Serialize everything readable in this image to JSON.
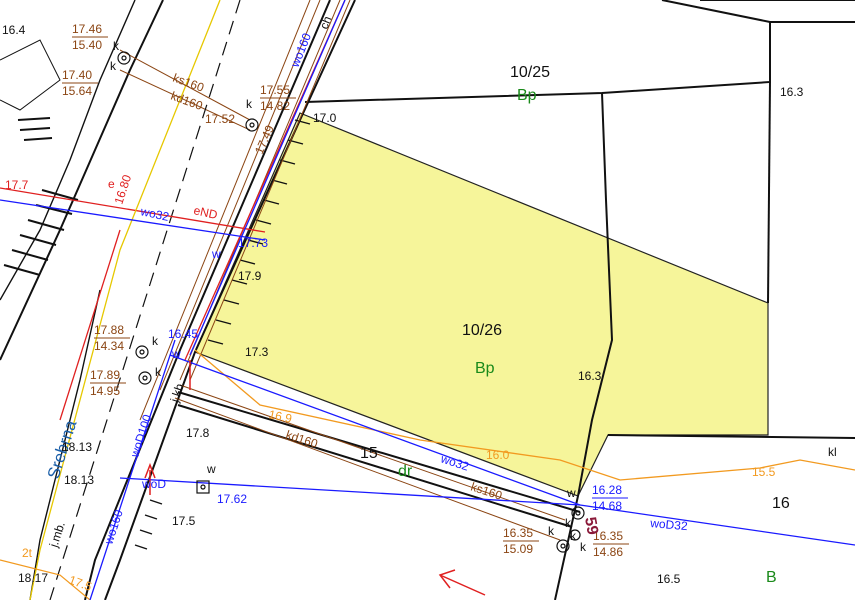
{
  "map": {
    "street": "Srebrna",
    "parcels": [
      {
        "id": "10/25",
        "use": "Bp"
      },
      {
        "id": "10/26",
        "use": "Bp"
      },
      {
        "id": "15",
        "use": "dr"
      },
      {
        "id": "16",
        "use": "B"
      }
    ],
    "highlight_color": "#f6f59a",
    "elevations": [
      "16.4",
      "17.0",
      "16.3",
      "17.52",
      "17.49",
      "17.9",
      "17.3",
      "16.3",
      "18.13",
      "18.13",
      "17.8",
      "17.5",
      "18.17",
      "16.5",
      "17.7"
    ],
    "level_pairs": [
      {
        "top": "17.46",
        "bottom": "15.40"
      },
      {
        "top": "17.40",
        "bottom": "15.64"
      },
      {
        "top": "17.55",
        "bottom": "14.82"
      },
      {
        "top": "17.88",
        "bottom": "14.34"
      },
      {
        "top": "17.89",
        "bottom": "14.95"
      },
      {
        "top": "16.28",
        "bottom": "14.68"
      },
      {
        "top": "16.35",
        "bottom": "15.09"
      },
      {
        "top": "16.35",
        "bottom": "14.86"
      }
    ],
    "utility_labels": {
      "ks160_a": "ks160",
      "kd160_a": "kd160",
      "ks160_b": "ks160",
      "kd160_b": "kd160",
      "wo160_a": "wo160",
      "wo160_b": "wo160",
      "woD100": "woD100",
      "wo32_a": "wo32",
      "wo32_b": "wo32",
      "woD": "woD",
      "woD32": "woD32",
      "eND": "eND",
      "ch": "ch",
      "jkb": "j.kb.",
      "jmb": "j.mb.",
      "e": "e",
      "w1": "w",
      "w2": "w",
      "w3": "w",
      "w4": "w",
      "k_marks": [
        "k",
        "k",
        "k",
        "k",
        "k",
        "k",
        "k",
        "k",
        "k"
      ],
      "kl": "kl",
      "number_59": "59",
      "wire_2t": "2t"
    },
    "blue_values": {
      "v1": "17.73",
      "v2": "16.45",
      "v3": "17.62"
    },
    "red_values": {
      "v1": "16.80"
    },
    "orange_values": {
      "v1": "16.9",
      "v2": "16.0",
      "v3": "15.5",
      "v4": "17.5"
    }
  }
}
